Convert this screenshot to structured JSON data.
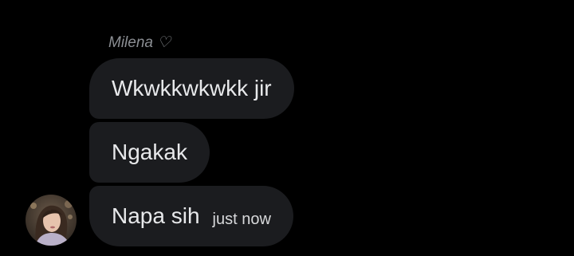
{
  "chat": {
    "sender_name": "Milena ♡",
    "messages": [
      {
        "text": "Wkwkkwkwkk jir",
        "time": ""
      },
      {
        "text": "Ngakak",
        "time": ""
      },
      {
        "text": "Napa sih",
        "time": "just now"
      }
    ],
    "avatar_icon": "user-avatar-photo"
  },
  "colors": {
    "background": "#000000",
    "bubble": "#1b1c1f",
    "text": "#e8e9eb",
    "name": "#8b8e93"
  }
}
